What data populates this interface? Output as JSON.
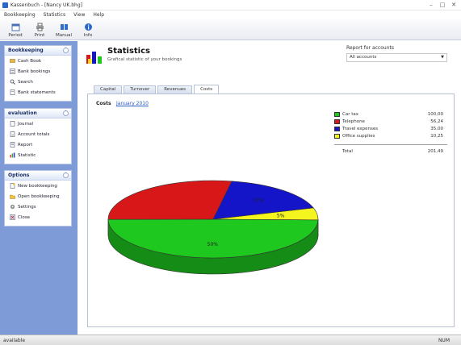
{
  "window": {
    "title": "Kassenbuch - [Nancy UK.bhg]"
  },
  "menu": [
    "Bookkeeping",
    "Statistics",
    "View",
    "Help"
  ],
  "toolbar": [
    {
      "label": "Period",
      "icon": "calendar-icon"
    },
    {
      "label": "Print",
      "icon": "printer-icon"
    },
    {
      "label": "Manual",
      "icon": "book-icon"
    },
    {
      "label": "Info",
      "icon": "info-icon"
    }
  ],
  "sidebar": {
    "bookkeeping": {
      "title": "Bookkeeping",
      "items": [
        {
          "label": "Cash Book",
          "icon": "cash-icon"
        },
        {
          "label": "Bank bookings",
          "icon": "bank-icon"
        },
        {
          "label": "Search",
          "icon": "search-icon"
        },
        {
          "label": "Bank statements",
          "icon": "statement-icon"
        }
      ]
    },
    "evaluation": {
      "title": "evaluation",
      "items": [
        {
          "label": "Journal",
          "icon": "journal-icon"
        },
        {
          "label": "Account totals",
          "icon": "totals-icon"
        },
        {
          "label": "Report",
          "icon": "report-icon"
        },
        {
          "label": "Statistic",
          "icon": "chart-icon"
        }
      ]
    },
    "options": {
      "title": "Options",
      "items": [
        {
          "label": "New bookkeeping",
          "icon": "new-file-icon"
        },
        {
          "label": "Open bookkeeping",
          "icon": "open-folder-icon"
        },
        {
          "label": "Settings",
          "icon": "gear-icon"
        },
        {
          "label": "Close",
          "icon": "close-icon"
        }
      ]
    }
  },
  "header": {
    "title": "Statistics",
    "subtitle": "Grafical statistic of your bookings",
    "report_label": "Report for accounts",
    "report_value": "All accounts"
  },
  "tabs": [
    {
      "label": "Capital",
      "active": false
    },
    {
      "label": "Turnover",
      "active": false
    },
    {
      "label": "Revenues",
      "active": false
    },
    {
      "label": "Costs",
      "active": true
    }
  ],
  "costs": {
    "label": "Costs",
    "month": "January 2010"
  },
  "chart_data": {
    "type": "pie",
    "categories": [
      "Car tax",
      "Telephone",
      "Travel expenses",
      "Office supplies"
    ],
    "values": [
      100.0,
      56.24,
      35.0,
      10.25
    ],
    "colors": [
      "#1ec81e",
      "#d81818",
      "#1414c8",
      "#f4f41e"
    ],
    "slice_labels": [
      "50%",
      "",
      "17%",
      "5%"
    ],
    "total_label": "Total",
    "total_value": "201,49",
    "display_values": [
      "100,00",
      "56,24",
      "35,00",
      "10,25"
    ]
  },
  "status": {
    "left": "available",
    "right": "NUM"
  }
}
